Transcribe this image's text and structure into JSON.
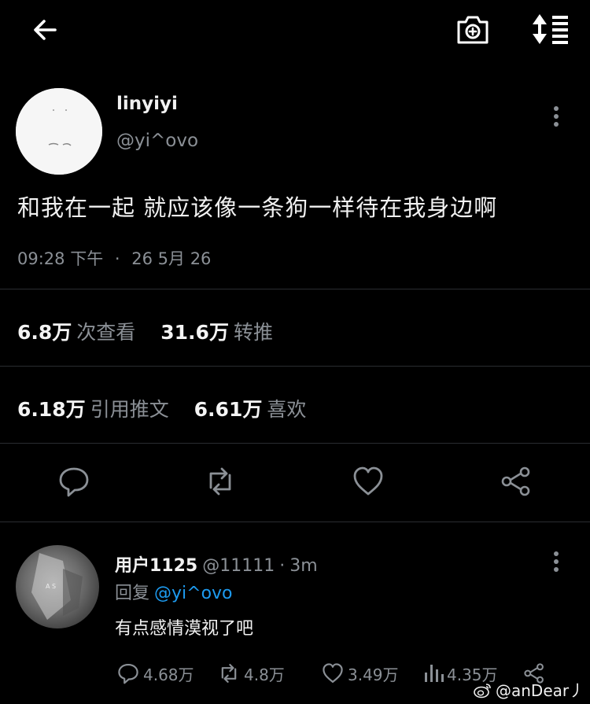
{
  "header": {
    "back_icon": "arrow-left-icon",
    "camera_icon": "camera-plus-icon",
    "sort_icon": "sort-list-icon"
  },
  "tweet": {
    "author_name": "linyiyi",
    "author_handle": "@yi^ovo",
    "text": "和我在一起 就应该像一条狗一样待在我身边啊",
    "time": "09:28 下午",
    "meta_sep": "·",
    "date": "26 5月 26",
    "stats": {
      "views_value": "6.8万",
      "views_label": "次查看",
      "retweets_value": "31.6万",
      "retweets_label": "转推",
      "quotes_value": "6.18万",
      "quotes_label": "引用推文",
      "likes_value": "6.61万",
      "likes_label": "喜欢"
    },
    "actions": [
      "reply-icon",
      "retweet-icon",
      "like-icon",
      "share-icon"
    ]
  },
  "reply": {
    "name": "用户1125",
    "handle": "@11111",
    "sep": "·",
    "time": "3m",
    "reply_prefix": "回复",
    "reply_to": "@yi^ovo",
    "text": "有点感情漠视了吧",
    "counts": {
      "replies": "4.68万",
      "retweets": "4.8万",
      "likes": "3.49万",
      "views": "4.35万"
    }
  },
  "watermark": {
    "text": "@anDear丿",
    "icon": "weibo-icon"
  },
  "colors": {
    "background": "#000000",
    "text": "#f1f1f1",
    "muted": "#8b9096",
    "accent": "#1d9bf0",
    "divider": "#2a2d31"
  }
}
